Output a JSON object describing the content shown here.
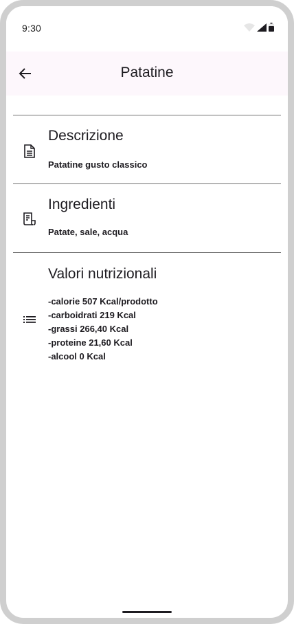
{
  "status_bar": {
    "time": "9:30",
    "icons": [
      "wifi-icon",
      "signal-icon",
      "battery-icon"
    ]
  },
  "app_bar": {
    "title": "Patatine",
    "back_icon": "arrow-back-icon"
  },
  "sections": {
    "description": {
      "icon": "document-icon",
      "title": "Descrizione",
      "text": "Patatine gusto classico"
    },
    "ingredients": {
      "icon": "receipt-icon",
      "title": "Ingredienti",
      "text": "Patate, sale, acqua"
    },
    "nutrition": {
      "icon": "list-icon",
      "title": "Valori nutrizionali",
      "lines": [
        "-calorie 507 Kcal/prodotto",
        "-carboidrati 219 Kcal",
        "-grassi 266,40 Kcal",
        "-proteine 21,60 Kcal",
        "-alcool 0 Kcal"
      ]
    }
  },
  "colors": {
    "app_bar_bg": "#fdf7fc",
    "text": "#1d1b20",
    "divider": "#6f6f6f",
    "frame": "#cfcfcf"
  }
}
